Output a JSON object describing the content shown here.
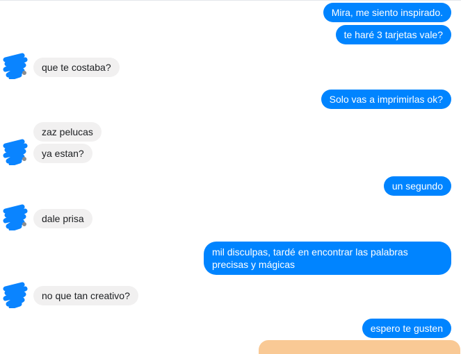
{
  "colors": {
    "outgoing_bubble": "#0084ff",
    "outgoing_text": "#ffffff",
    "incoming_bubble": "#f1f0f0",
    "incoming_text": "#1c1e21",
    "avatar_scribble": "#0a84ff",
    "peek_bubble": "#f9c995"
  },
  "messages": [
    {
      "direction": "outgoing",
      "text": "Mira, me siento inspirado."
    },
    {
      "direction": "outgoing",
      "text": "te haré 3 tarjetas vale?"
    },
    {
      "direction": "incoming",
      "text": "que te costaba?"
    },
    {
      "direction": "outgoing",
      "text": "Solo vas a imprimirlas ok?"
    },
    {
      "direction": "incoming",
      "text": "zaz pelucas"
    },
    {
      "direction": "incoming",
      "text": "ya estan?"
    },
    {
      "direction": "outgoing",
      "text": "un segundo"
    },
    {
      "direction": "incoming",
      "text": "dale prisa"
    },
    {
      "direction": "outgoing",
      "text": "mil disculpas, tardé en encontrar las palabras precisas y mágicas"
    },
    {
      "direction": "incoming",
      "text": "no que tan creativo?"
    },
    {
      "direction": "outgoing",
      "text": "espero te gusten"
    }
  ],
  "avatars": [
    {
      "icon": "scribbled-avatar-icon"
    },
    {
      "icon": "scribbled-avatar-icon"
    },
    {
      "icon": "scribbled-avatar-icon"
    },
    {
      "icon": "scribbled-avatar-icon"
    }
  ]
}
